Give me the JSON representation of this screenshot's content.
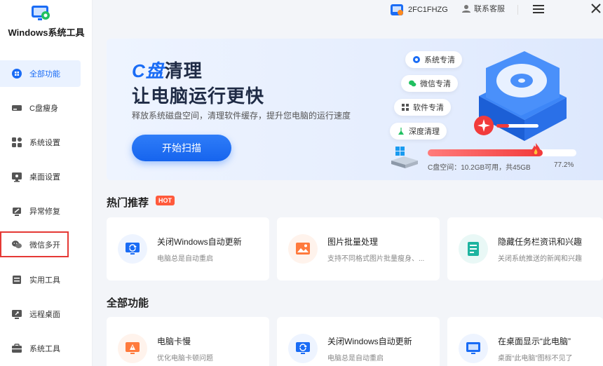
{
  "app": {
    "title": "Windows系统工具"
  },
  "sidebar": {
    "items": [
      {
        "label": "全部功能",
        "icon": "grid-home-icon"
      },
      {
        "label": "C盘瘦身",
        "icon": "drive-icon"
      },
      {
        "label": "系统设置",
        "icon": "settings-grid-icon"
      },
      {
        "label": "桌面设置",
        "icon": "desktop-icon"
      },
      {
        "label": "异常修复",
        "icon": "repair-icon"
      },
      {
        "label": "微信多开",
        "icon": "wechat-icon"
      },
      {
        "label": "实用工具",
        "icon": "toolbox-icon"
      },
      {
        "label": "远程桌面",
        "icon": "remote-icon"
      },
      {
        "label": "系统工具",
        "icon": "briefcase-icon"
      }
    ]
  },
  "topbar": {
    "account_name": "2FC1FHZG",
    "service_label": "联系客服"
  },
  "banner": {
    "title_c": "C盘",
    "title_rest": "清理",
    "title_line2": "让电脑运行更快",
    "subtitle": "释放系统磁盘空间，清理软件缓存，提升您电脑的运行速度",
    "scan_button": "开始扫描",
    "chips": [
      "系统专清",
      "微信专清",
      "软件专清",
      "深度清理"
    ],
    "disk_label": "C盘空间：",
    "disk_detail": "10.2GB可用，共45GB",
    "disk_percent": "77.2%",
    "disk_usage_fraction": 0.772
  },
  "hot": {
    "title": "热门推荐",
    "badge": "HOT",
    "cards": [
      {
        "title": "关闭Windows自动更新",
        "desc": "电脑总是自动重启"
      },
      {
        "title": "图片批量处理",
        "desc": "支持不同格式图片批量瘦身、..."
      },
      {
        "title": "隐藏任务栏资讯和兴趣",
        "desc": "关闭系统推送的新闻和兴趣"
      }
    ]
  },
  "all": {
    "title": "全部功能",
    "cards": [
      {
        "title": "电脑卡慢",
        "desc": "优化电脑卡顿问题"
      },
      {
        "title": "关闭Windows自动更新",
        "desc": "电脑总是自动重启"
      },
      {
        "title": "在桌面显示“此电脑”",
        "desc": "桌面“此电脑”图标不见了"
      }
    ]
  },
  "colors": {
    "accent": "#1a6cf5",
    "highlight": "#e53935",
    "hot": "#ff5a3c",
    "danger": "#f23b3b"
  }
}
